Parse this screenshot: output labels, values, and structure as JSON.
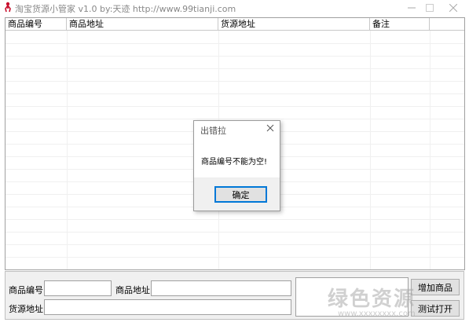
{
  "window": {
    "title": "淘宝货源小管家 v1.0  by:天迹 http://www.99tianji.com"
  },
  "listview": {
    "columns": [
      "商品编号",
      "商品地址",
      "货源地址",
      "备注"
    ],
    "rows": []
  },
  "form": {
    "product_id_label": "商品编号:",
    "product_id_value": "",
    "product_url_label": "商品地址:",
    "product_url_value": "",
    "source_url_label": "货源地址:",
    "source_url_value": "",
    "notes_value": "",
    "add_button": "增加商品",
    "second_button": "测试打开"
  },
  "dialog": {
    "title": "出错拉",
    "message": "商品编号不能为空!",
    "ok_button": "确定"
  },
  "watermark": {
    "text": "绿色资源",
    "subtext": "www.xxxxxxxx.com"
  },
  "colors": {
    "accent": "#0078d7",
    "icon_red": "#c8102e",
    "dialog_footer": "#f0f0f0"
  }
}
